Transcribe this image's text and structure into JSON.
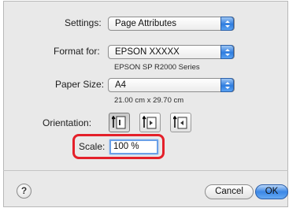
{
  "settings": {
    "label": "Settings:",
    "value": "Page Attributes"
  },
  "format_for": {
    "label": "Format for:",
    "value": "EPSON XXXXX",
    "subtext": "EPSON SP R2000 Series"
  },
  "paper_size": {
    "label": "Paper Size:",
    "value": "A4",
    "subtext": "21.00 cm x 29.70 cm"
  },
  "orientation": {
    "label": "Orientation:",
    "options": [
      {
        "icon": "portrait-orientation-icon",
        "selected": true
      },
      {
        "icon": "landscape-left-orientation-icon",
        "selected": false
      },
      {
        "icon": "landscape-right-orientation-icon",
        "selected": false
      }
    ]
  },
  "scale": {
    "label": "Scale:",
    "value": "100 %"
  },
  "help": {
    "symbol": "?"
  },
  "buttons": {
    "cancel": "Cancel",
    "ok": "OK"
  },
  "colors": {
    "highlight": "#e4202a",
    "default_button": "#3b87e6",
    "popup_arrows": "#2f7de0"
  }
}
